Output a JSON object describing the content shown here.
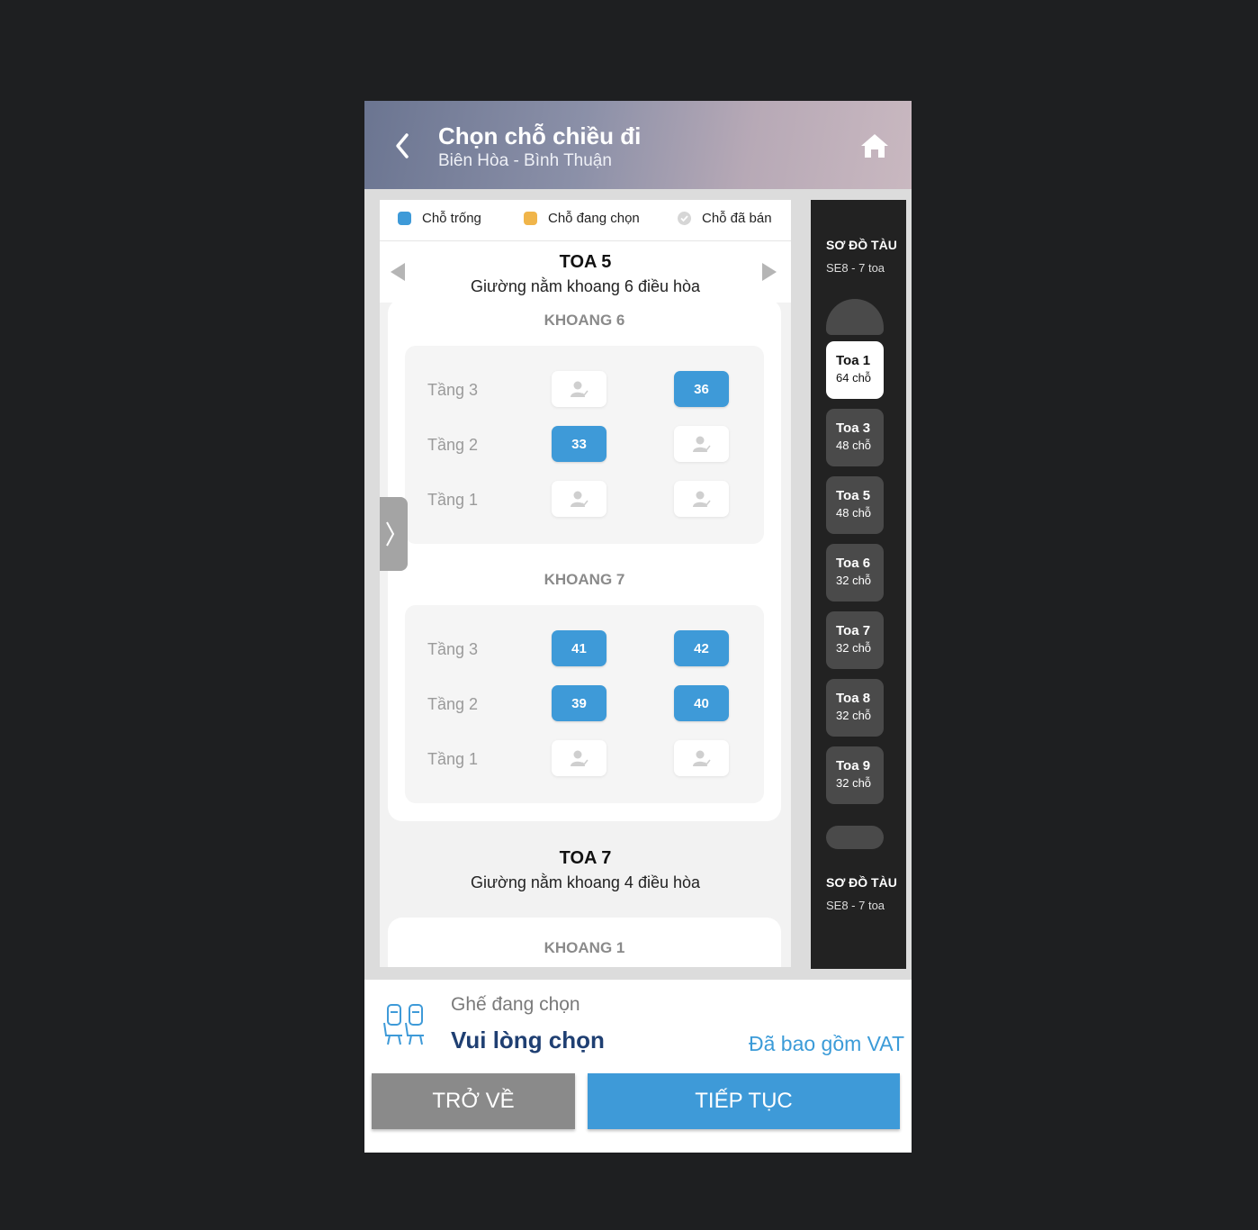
{
  "header": {
    "title": "Chọn chỗ chiều đi",
    "route": "Biên Hòa - Bình Thuận"
  },
  "legend": [
    {
      "label": "Chỗ trống",
      "color": "#3e9ad8"
    },
    {
      "label": "Chỗ đang chọn",
      "color": "#f0b54a"
    },
    {
      "label": "Chỗ đã bán",
      "color": "#d6d6d6"
    }
  ],
  "coach": {
    "title": "TOA 5",
    "description": "Giường nằm khoang 6 điều hòa"
  },
  "compartments": [
    {
      "title": "KHOANG 6",
      "rows": [
        {
          "floor": "Tầng 3",
          "seats": [
            "sold",
            "36"
          ]
        },
        {
          "floor": "Tầng 2",
          "seats": [
            "33",
            "sold"
          ]
        },
        {
          "floor": "Tầng 1",
          "seats": [
            "sold",
            "sold"
          ]
        }
      ]
    },
    {
      "title": "KHOANG 7",
      "rows": [
        {
          "floor": "Tầng 3",
          "seats": [
            "41",
            "42"
          ]
        },
        {
          "floor": "Tầng 2",
          "seats": [
            "39",
            "40"
          ]
        },
        {
          "floor": "Tầng 1",
          "seats": [
            "sold",
            "sold"
          ]
        }
      ]
    }
  ],
  "next_coach": {
    "title": "TOA 7",
    "description": "Giường nằm khoang 4 điều hòa",
    "first_compartment": "KHOANG 1"
  },
  "train_map": {
    "heading": "SƠ ĐỒ TÀU",
    "train": "SE8 - 7 toa",
    "coaches": [
      {
        "name": "Toa 1",
        "count": "64 chỗ",
        "active": true
      },
      {
        "name": "Toa 3",
        "count": "48 chỗ",
        "active": false
      },
      {
        "name": "Toa 5",
        "count": "48 chỗ",
        "active": false
      },
      {
        "name": "Toa 6",
        "count": "32 chỗ",
        "active": false
      },
      {
        "name": "Toa 7",
        "count": "32 chỗ",
        "active": false
      },
      {
        "name": "Toa 8",
        "count": "32 chỗ",
        "active": false
      },
      {
        "name": "Toa 9",
        "count": "32 chỗ",
        "active": false
      }
    ]
  },
  "bottom": {
    "selected_label": "Ghế đang chọn",
    "selected_value": "Vui lòng chọn",
    "vat_note": "Đã bao gồm VAT",
    "back_label": "TRỞ VỀ",
    "next_label": "TIẾP TỤC"
  }
}
